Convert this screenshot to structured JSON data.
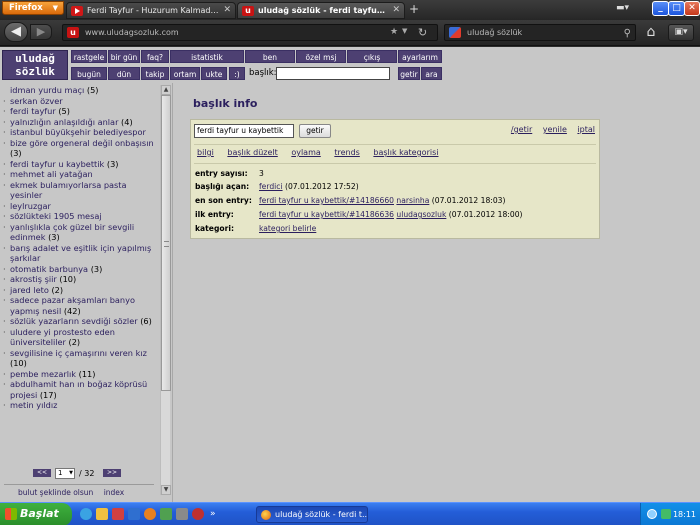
{
  "browser": {
    "app_button": "Firefox",
    "tabs": [
      {
        "title": "Ferdi Tayfur - Huzurum Kalmadı (Full Fil..."
      },
      {
        "title": "uludağ sözlük - ferdi tayfur u kay..."
      }
    ],
    "url": "www.uludagsozluk.com",
    "search_value": "uludağ sözlük"
  },
  "site": {
    "logo_line1": "uludağ",
    "logo_line2": "sözlük",
    "top_row1": [
      "rastgele",
      "bir gün",
      "faq?",
      "istatistik",
      "ben",
      "özel msj",
      "çıkış",
      "ayarlarım"
    ],
    "top_row2": [
      "bugün",
      "dün",
      "takip",
      "ortam",
      "ukte",
      ":)"
    ],
    "baslik_label": "başlık:",
    "getir": "getir",
    "ara": "ara"
  },
  "sidebar": {
    "items": [
      {
        "text": "idman yurdu maçı",
        "count": "(5)",
        "bullet": ""
      },
      {
        "text": "serkan özver",
        "count": "",
        "bullet": "·"
      },
      {
        "text": "ferdi tayfur",
        "count": "(5)",
        "bullet": "·"
      },
      {
        "text": "yalnızlığın anlaşıldığı anlar",
        "count": "(4)",
        "bullet": "·"
      },
      {
        "text": "istanbul büyükşehir belediyespor",
        "count": "",
        "bullet": "·"
      },
      {
        "text": "bize göre orgeneral değil onbaşısın",
        "count": "(3)",
        "bullet": "·"
      },
      {
        "text": "ferdi tayfur u kaybettik",
        "count": "(3)",
        "bullet": "·"
      },
      {
        "text": "mehmet ali yatağan",
        "count": "",
        "bullet": "·"
      },
      {
        "text": "ekmek bulamıyorlarsa pasta yesinler",
        "count": "",
        "bullet": "·"
      },
      {
        "text": "leylruzgar",
        "count": "",
        "bullet": "·"
      },
      {
        "text": "sözlükteki 1905 mesaj",
        "count": "",
        "bullet": "·"
      },
      {
        "text": "yanlışlıkla çok güzel bir sevgili edinmek",
        "count": "(3)",
        "bullet": "·"
      },
      {
        "text": "barış adalet ve eşitlik için yapılmış şarkılar",
        "count": "",
        "bullet": "·"
      },
      {
        "text": "otomatik barbunya",
        "count": "(3)",
        "bullet": "·"
      },
      {
        "text": "akrostiş şiir",
        "count": "(10)",
        "bullet": "·"
      },
      {
        "text": "jared leto",
        "count": "(2)",
        "bullet": "·"
      },
      {
        "text": "sadece pazar akşamları banyo yapmış nesil",
        "count": "(42)",
        "bullet": "·"
      },
      {
        "text": "sözlük yazarların sevdiği sözler",
        "count": "(6)",
        "bullet": "·"
      },
      {
        "text": "uludere yi prostesto eden üniversiteliler",
        "count": "(2)",
        "bullet": "·"
      },
      {
        "text": "sevgilisine iç çamaşırını veren kız",
        "count": "(10)",
        "bullet": "·"
      },
      {
        "text": "pembe mezarlık",
        "count": "(11)",
        "bullet": "·"
      },
      {
        "text": "abdulhamit han ın boğaz köprüsü projesi",
        "count": "(17)",
        "bullet": "·"
      },
      {
        "text": "metin yıldız",
        "count": "",
        "bullet": "·"
      }
    ],
    "pager_prev": "<<",
    "pager_next": ">>",
    "page_current": "1",
    "page_total": "/ 32",
    "footer_left": "bulut şeklinde olsun",
    "footer_right": "index"
  },
  "main": {
    "title": "başlık info",
    "input_value": "ferdi tayfur u kaybettik",
    "getir_btn": "getir",
    "actions": [
      "/getir",
      "yenile",
      "iptal"
    ],
    "tabs": [
      "bilgi",
      "başlık düzelt",
      "oylama",
      "trends",
      "başlık kategorisi"
    ],
    "rows": [
      {
        "label": "entry sayısı:",
        "value": "3"
      },
      {
        "label": "başlığı açan:",
        "link": "ferdici",
        "rest": " (07.01.2012 17:52)"
      },
      {
        "label": "en son entry:",
        "link": "ferdi tayfur u kaybettik/#14186660",
        "link2": "narsinha",
        "rest": " (07.01.2012 18:03)"
      },
      {
        "label": "ilk entry:",
        "link": "ferdi tayfur u kaybettik/#14186636",
        "link2": "uludagsozluk",
        "rest": " (07.01.2012 18:00)"
      },
      {
        "label": "kategori:",
        "link": "kategori belirle"
      }
    ]
  },
  "taskbar": {
    "start": "Başlat",
    "task": "uludağ sözlük - ferdi t...",
    "clock": "18:11"
  }
}
